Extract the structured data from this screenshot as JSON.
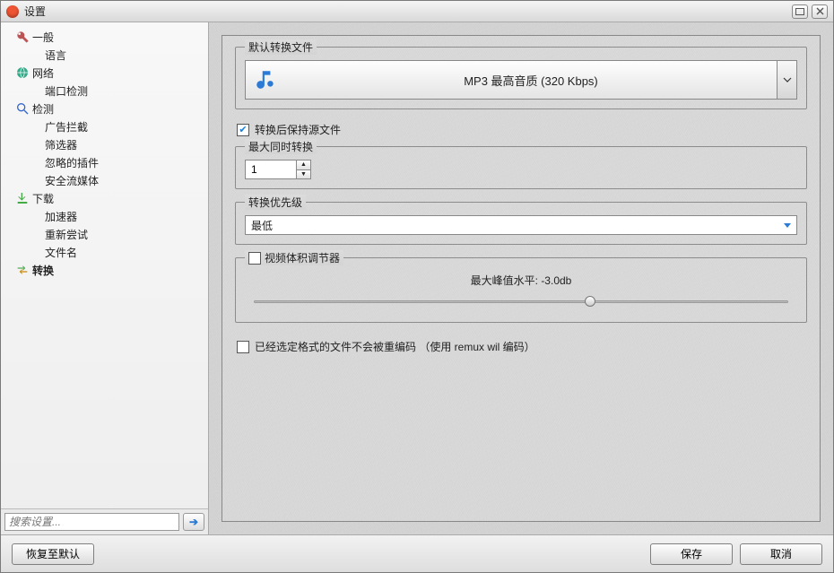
{
  "window": {
    "title": "设置"
  },
  "sidebar": {
    "nodes": [
      {
        "label": "一般",
        "icon": "wrench"
      },
      {
        "label": "语言",
        "child": true
      },
      {
        "label": "网络",
        "icon": "globe"
      },
      {
        "label": "端口检测",
        "child": true
      },
      {
        "label": "检测",
        "icon": "magnifier"
      },
      {
        "label": "广告拦截",
        "child": true
      },
      {
        "label": "筛选器",
        "child": true
      },
      {
        "label": "忽略的插件",
        "child": true
      },
      {
        "label": "安全流媒体",
        "child": true
      },
      {
        "label": "下载",
        "icon": "download"
      },
      {
        "label": "加速器",
        "child": true
      },
      {
        "label": "重新尝试",
        "child": true
      },
      {
        "label": "文件名",
        "child": true
      },
      {
        "label": "转换",
        "icon": "convert",
        "selected": true
      }
    ],
    "search_placeholder": "搜索设置..."
  },
  "content": {
    "group_default": {
      "legend": "默认转换文件",
      "selected": "MP3 最高音质 (320 Kbps)"
    },
    "keep_source": {
      "label": "转换后保持源文件",
      "checked": true
    },
    "group_concurrent": {
      "legend": "最大同时转换",
      "value": "1"
    },
    "group_priority": {
      "legend": "转换优先级",
      "selected": "最低"
    },
    "group_volume": {
      "legend": "视频体积调节器",
      "checked": false,
      "caption_prefix": "最大峰值水平: ",
      "caption_value": "-3.0db",
      "slider_percent": 63
    },
    "remux": {
      "checked": false,
      "label": "已经选定格式的文件不会被重编码 （使用 remux wil 编码）"
    }
  },
  "footer": {
    "restore": "恢复至默认",
    "save": "保存",
    "cancel": "取消"
  }
}
